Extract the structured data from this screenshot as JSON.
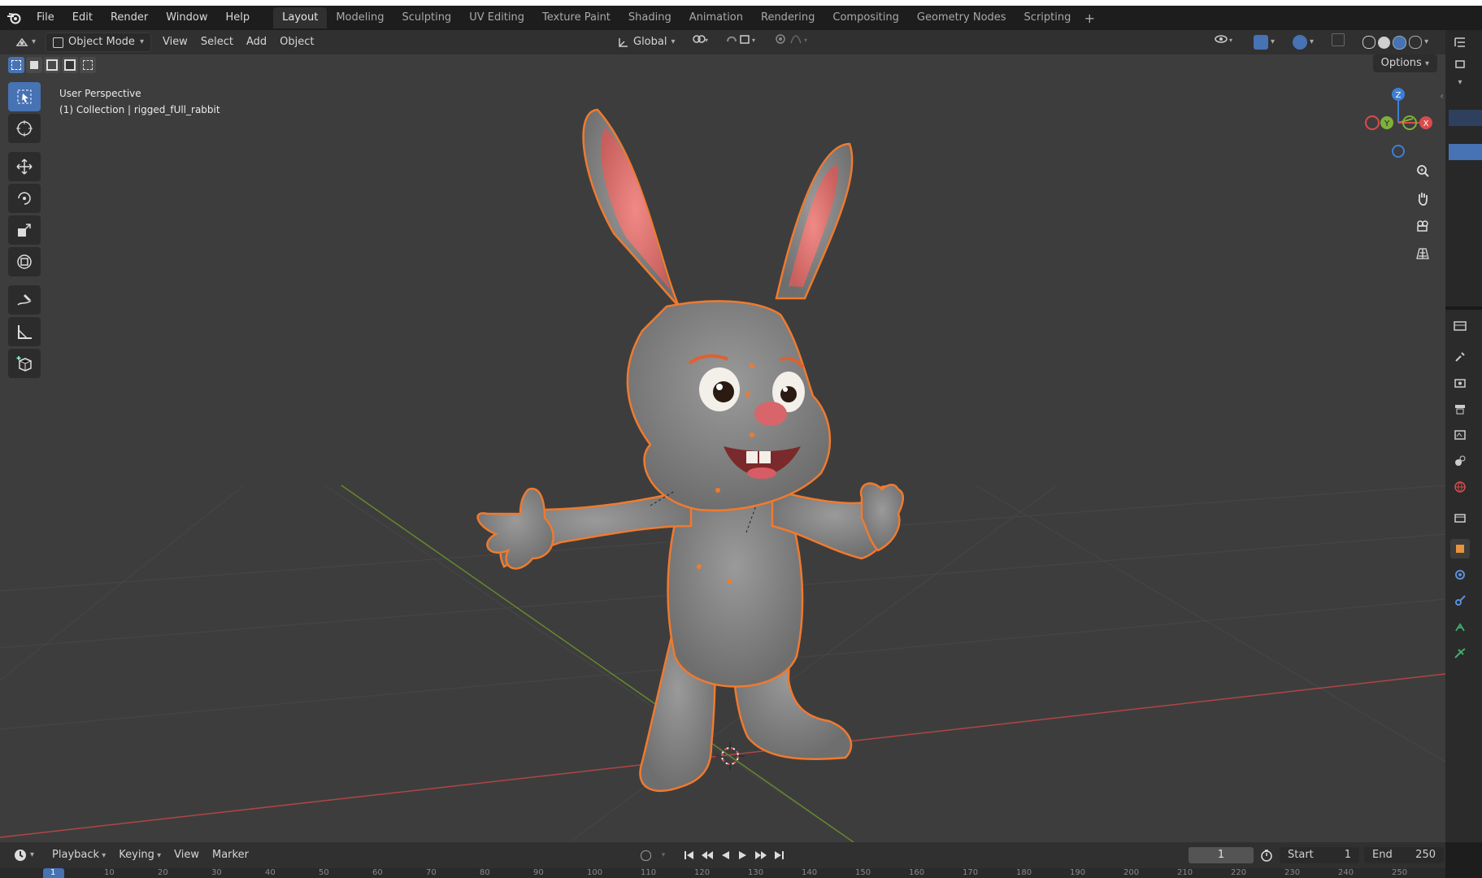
{
  "app": {
    "menus": [
      "File",
      "Edit",
      "Render",
      "Window",
      "Help"
    ],
    "workspaces": [
      "Layout",
      "Modeling",
      "Sculpting",
      "UV Editing",
      "Texture Paint",
      "Shading",
      "Animation",
      "Rendering",
      "Compositing",
      "Geometry Nodes",
      "Scripting"
    ],
    "active_workspace": "Layout",
    "add_workspace_label": "+"
  },
  "viewport_header": {
    "mode": "Object Mode",
    "menus": [
      "View",
      "Select",
      "Add",
      "Object"
    ],
    "transform_orientation": "Global",
    "options_label": "Options"
  },
  "viewport_info": {
    "perspective": "User Perspective",
    "collection_line": "(1) Collection | rigged_fUll_rabbit"
  },
  "gizmo": {
    "z": "Z",
    "y": "Y",
    "x": "X"
  },
  "tools": [
    "select-box",
    "cursor",
    "move",
    "rotate",
    "scale",
    "transform",
    "annotate",
    "measure",
    "add-cube"
  ],
  "timeline": {
    "menus": [
      "Playback",
      "Keying",
      "View",
      "Marker"
    ],
    "current_frame": "1",
    "start_label": "Start",
    "start_value": "1",
    "end_label": "End",
    "end_value": "250",
    "ruler_marks": [
      "1",
      "10",
      "20",
      "30",
      "40",
      "50",
      "60",
      "70",
      "80",
      "90",
      "100",
      "110",
      "120",
      "130",
      "140",
      "150",
      "160",
      "170",
      "180",
      "190",
      "200",
      "210",
      "220",
      "230",
      "240",
      "250"
    ]
  },
  "colors": {
    "accent": "#4772b3",
    "selection_outline": "#f07a2e",
    "axis_x": "#d94c4c",
    "axis_y": "#7fb03b",
    "axis_z": "#3d7fd6"
  }
}
